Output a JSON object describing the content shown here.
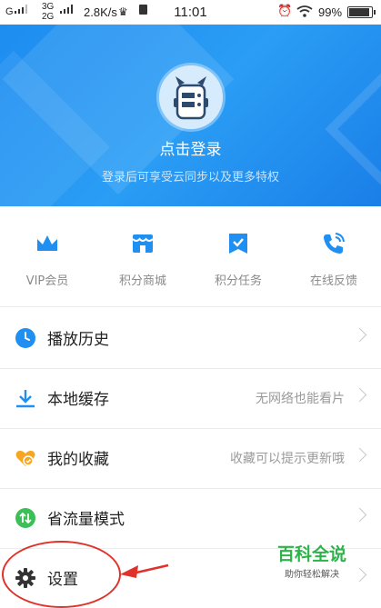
{
  "status_bar": {
    "carrier": "G",
    "network_top": "3G",
    "network_bottom": "2G",
    "speed": "2.8K/s",
    "time": "11:01",
    "battery": "99%"
  },
  "header": {
    "login": "点击登录",
    "subtitle": "登录后可享受云同步以及更多特权",
    "accent_color": "#1f8ff2"
  },
  "quick_actions": [
    {
      "label": "VIP会员",
      "icon": "crown-icon"
    },
    {
      "label": "积分商城",
      "icon": "store-icon"
    },
    {
      "label": "积分任务",
      "icon": "task-check-icon"
    },
    {
      "label": "在线反馈",
      "icon": "phone-feedback-icon"
    }
  ],
  "menu": [
    {
      "label": "播放历史",
      "right": "",
      "icon": "clock-icon"
    },
    {
      "label": "本地缓存",
      "right": "无网络也能看片",
      "icon": "download-icon"
    },
    {
      "label": "我的收藏",
      "right": "收藏可以提示更新哦",
      "icon": "heart-icon"
    },
    {
      "label": "省流量模式",
      "right": "",
      "icon": "data-saver-icon"
    },
    {
      "label": "设置",
      "right": "",
      "icon": "gear-icon"
    }
  ],
  "watermark": {
    "title": "百科全说",
    "subtitle": "助你轻松解决"
  }
}
